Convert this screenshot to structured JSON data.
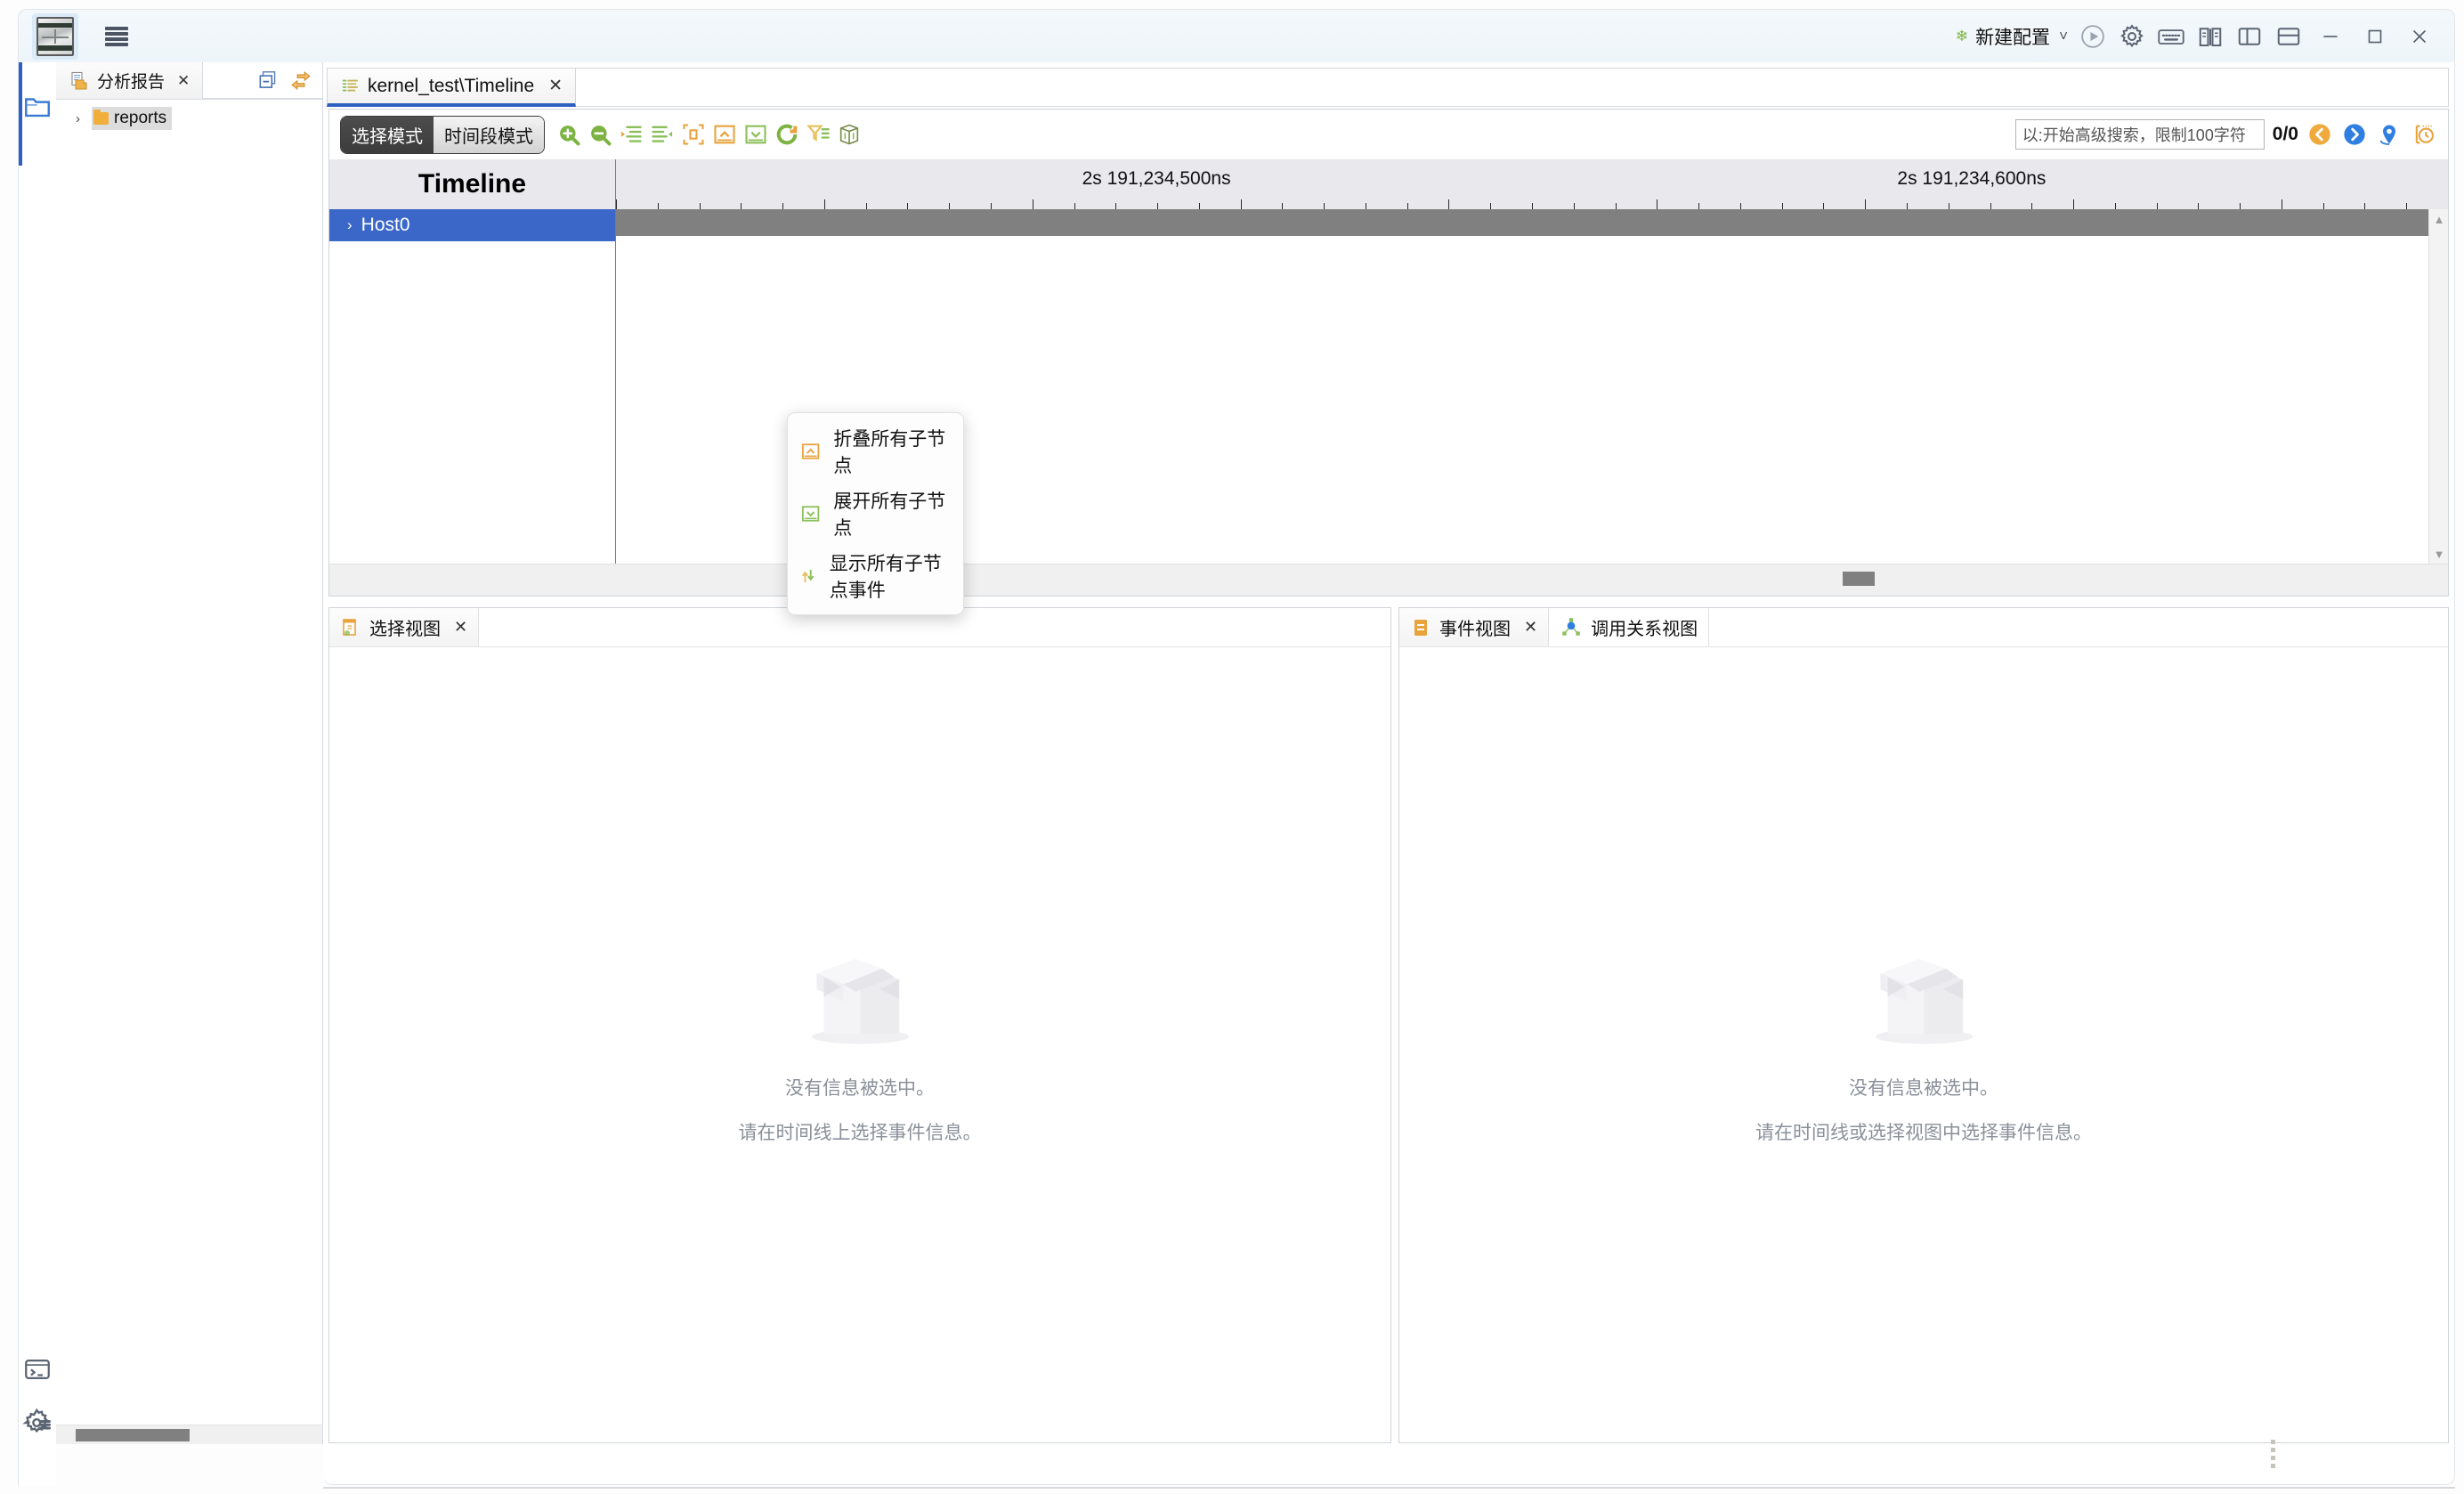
{
  "titlebar": {
    "config_label": "新建配置",
    "icons": [
      "leaf-icon",
      "chevron-down-icon",
      "run-icon",
      "settings-icon",
      "keyboard-icon",
      "book-icon",
      "layout-split-vertical-icon",
      "layout-split-horizontal-icon"
    ],
    "window_controls": [
      "minimize",
      "maximize",
      "close"
    ]
  },
  "rail": {
    "items": [
      {
        "name": "folder-icon"
      },
      {
        "name": "terminal-icon"
      },
      {
        "name": "settings-list-icon"
      }
    ]
  },
  "left_panel": {
    "tab_label": "分析报告",
    "tab_close": "✕",
    "actions": [
      "collapse-all-icon",
      "link-editor-icon"
    ],
    "tree": [
      {
        "label": "reports",
        "arrow": "›",
        "selected": true
      }
    ]
  },
  "editor": {
    "tab_label": "kernel_test\\Timeline",
    "tab_close": "✕"
  },
  "timeline_toolbar": {
    "mode_buttons": [
      {
        "label": "选择模式",
        "active": true
      },
      {
        "label": "时间段模式",
        "active": false
      }
    ],
    "icons": [
      "zoom-in-icon",
      "zoom-out-icon",
      "collapse-rows-icon",
      "expand-rows-icon",
      "fit-selection-icon",
      "collapse-all-icon",
      "expand-all-icon",
      "refresh-icon",
      "filter-icon",
      "3d-cube-icon"
    ],
    "search_placeholder": "以:开始高级搜索，限制100字符",
    "search_value": "",
    "match_count": "0/0",
    "search_icons": [
      "prev-match-icon",
      "next-match-icon",
      "locate-icon",
      "time-range-icon"
    ]
  },
  "timeline": {
    "header_title": "Timeline",
    "ruler_labels": [
      "2s 191,234,500ns",
      "2s 191,234,600ns"
    ],
    "rows": [
      {
        "label": "Host0",
        "arrow": "›",
        "selected": true,
        "has_bar": true
      }
    ]
  },
  "context_menu": {
    "items": [
      {
        "label": "折叠所有子节点",
        "icon": "collapse-node-icon"
      },
      {
        "label": "展开所有子节点",
        "icon": "expand-node-icon"
      },
      {
        "label": "显示所有子节点事件",
        "icon": "show-events-icon"
      }
    ]
  },
  "bottom_left_panel": {
    "tab_label": "选择视图",
    "tab_close": "✕",
    "empty_title": "没有信息被选中。",
    "empty_hint": "请在时间线上选择事件信息。"
  },
  "bottom_right_panel": {
    "tabs": [
      {
        "label": "事件视图",
        "icon": "clipboard-icon",
        "close": "✕",
        "active": true
      },
      {
        "label": "调用关系视图",
        "icon": "call-graph-icon",
        "active": false
      }
    ],
    "empty_title": "没有信息被选中。",
    "empty_hint": "请在时间线或选择视图中选择事件信息。"
  },
  "colors": {
    "accent_blue": "#2f5fc0",
    "selection_blue": "#3a67c8",
    "bar_gray": "#808080",
    "ruler_bg": "#e8e8ed",
    "green": "#7db544",
    "orange": "#e8a33d"
  }
}
